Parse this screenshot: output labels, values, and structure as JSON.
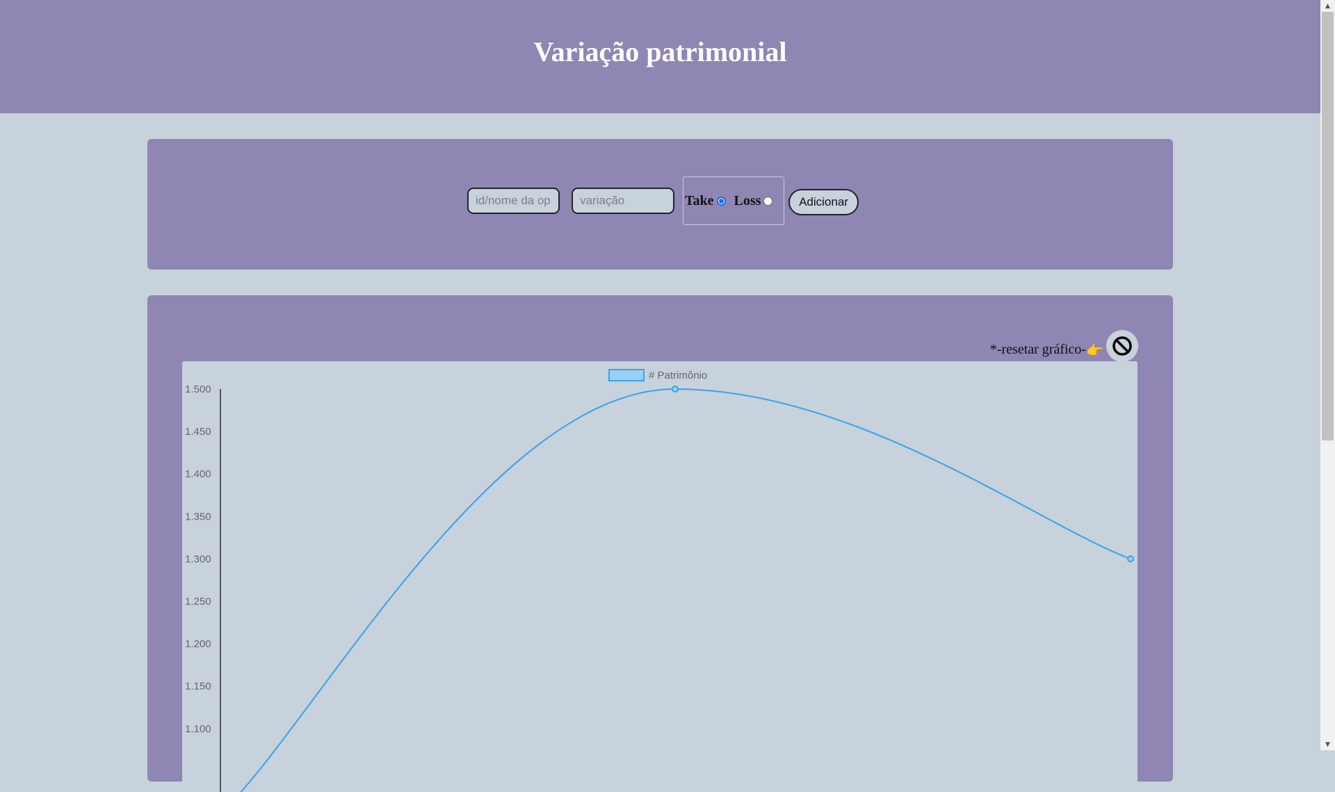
{
  "header": {
    "title": "Variação patrimonial"
  },
  "form": {
    "op_placeholder": "id/nome da op",
    "variation_placeholder": "variação",
    "take_label": "Take",
    "loss_label": "Loss",
    "selected": "take",
    "add_label": "Adicionar"
  },
  "chart_section": {
    "reset_label": "*-resetar gráfico-",
    "reset_hand_icon": "pointing-hand-icon",
    "reset_button_icon": "prohibited-icon"
  },
  "colors": {
    "header_bg": "#8f86b3",
    "page_bg": "#c7d2dc",
    "line": "#36a2eb",
    "legend_fill": "#9ad0f5"
  },
  "chart_data": {
    "type": "line",
    "legend": [
      "# Patrimônio"
    ],
    "series": [
      {
        "name": "# Patrimônio",
        "values": [
          1000,
          1500,
          1300
        ]
      }
    ],
    "yticks": [
      "1.500",
      "1.450",
      "1.400",
      "1.350",
      "1.300",
      "1.250",
      "1.200",
      "1.150",
      "1.100"
    ],
    "ylim": [
      1000,
      1500
    ],
    "smooth": true,
    "grid": false,
    "legend_position": "top"
  }
}
